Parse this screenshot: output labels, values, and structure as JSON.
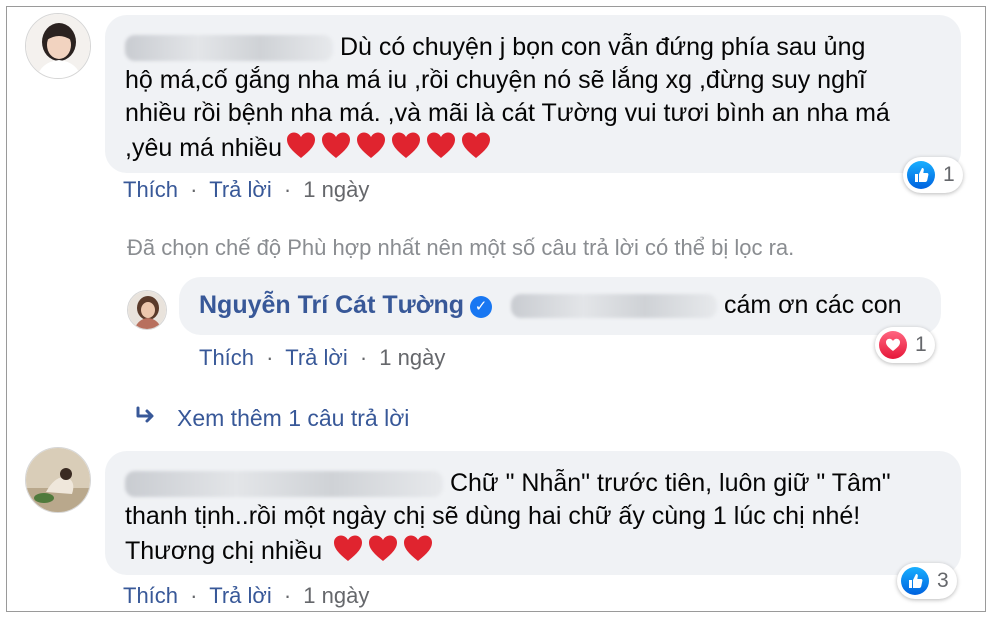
{
  "comment1": {
    "avatar_alt": "avatar",
    "text_line1": "Dù có chuyện j bọn con vẫn đứng phía sau ủng",
    "text_line2": "hộ má,cố gắng nha má iu ,rồi chuyện nó sẽ lắng xg ,đừng suy nghĩ",
    "text_line3": "nhiều rồi bệnh nha má. ,và mãi là cát Tường vui tươi bình an nha má",
    "text_line4": ",yêu má nhiều",
    "like": "Thích",
    "reply": "Trả lời",
    "time": "1 ngày",
    "reaction_count": "1"
  },
  "filter_notice": "Đã chọn chế độ Phù hợp nhất nên một số câu trả lời có thể bị lọc ra.",
  "reply1": {
    "author": "Nguyễn Trí Cát Tường",
    "text": "cám ơn các con",
    "like": "Thích",
    "reply": "Trả lời",
    "time": "1 ngày",
    "reaction_count": "1"
  },
  "view_more": "Xem thêm 1 câu trả lời",
  "comment2": {
    "text_line1": "Chữ \" Nhẫn\" trước tiên, luôn giữ \" Tâm\"",
    "text_line2": "thanh tịnh..rồi một ngày chị sẽ dùng hai chữ ấy cùng 1 lúc chị nhé!",
    "text_line3": "Thương chị nhiều",
    "like": "Thích",
    "reply": "Trả lời",
    "time": "1 ngày",
    "reaction_count": "3"
  },
  "colors": {
    "link": "#385898",
    "muted": "#65676b",
    "bubble": "#f0f2f5",
    "heart": "#e0242f",
    "like": "#1877f2"
  },
  "separator": "·"
}
